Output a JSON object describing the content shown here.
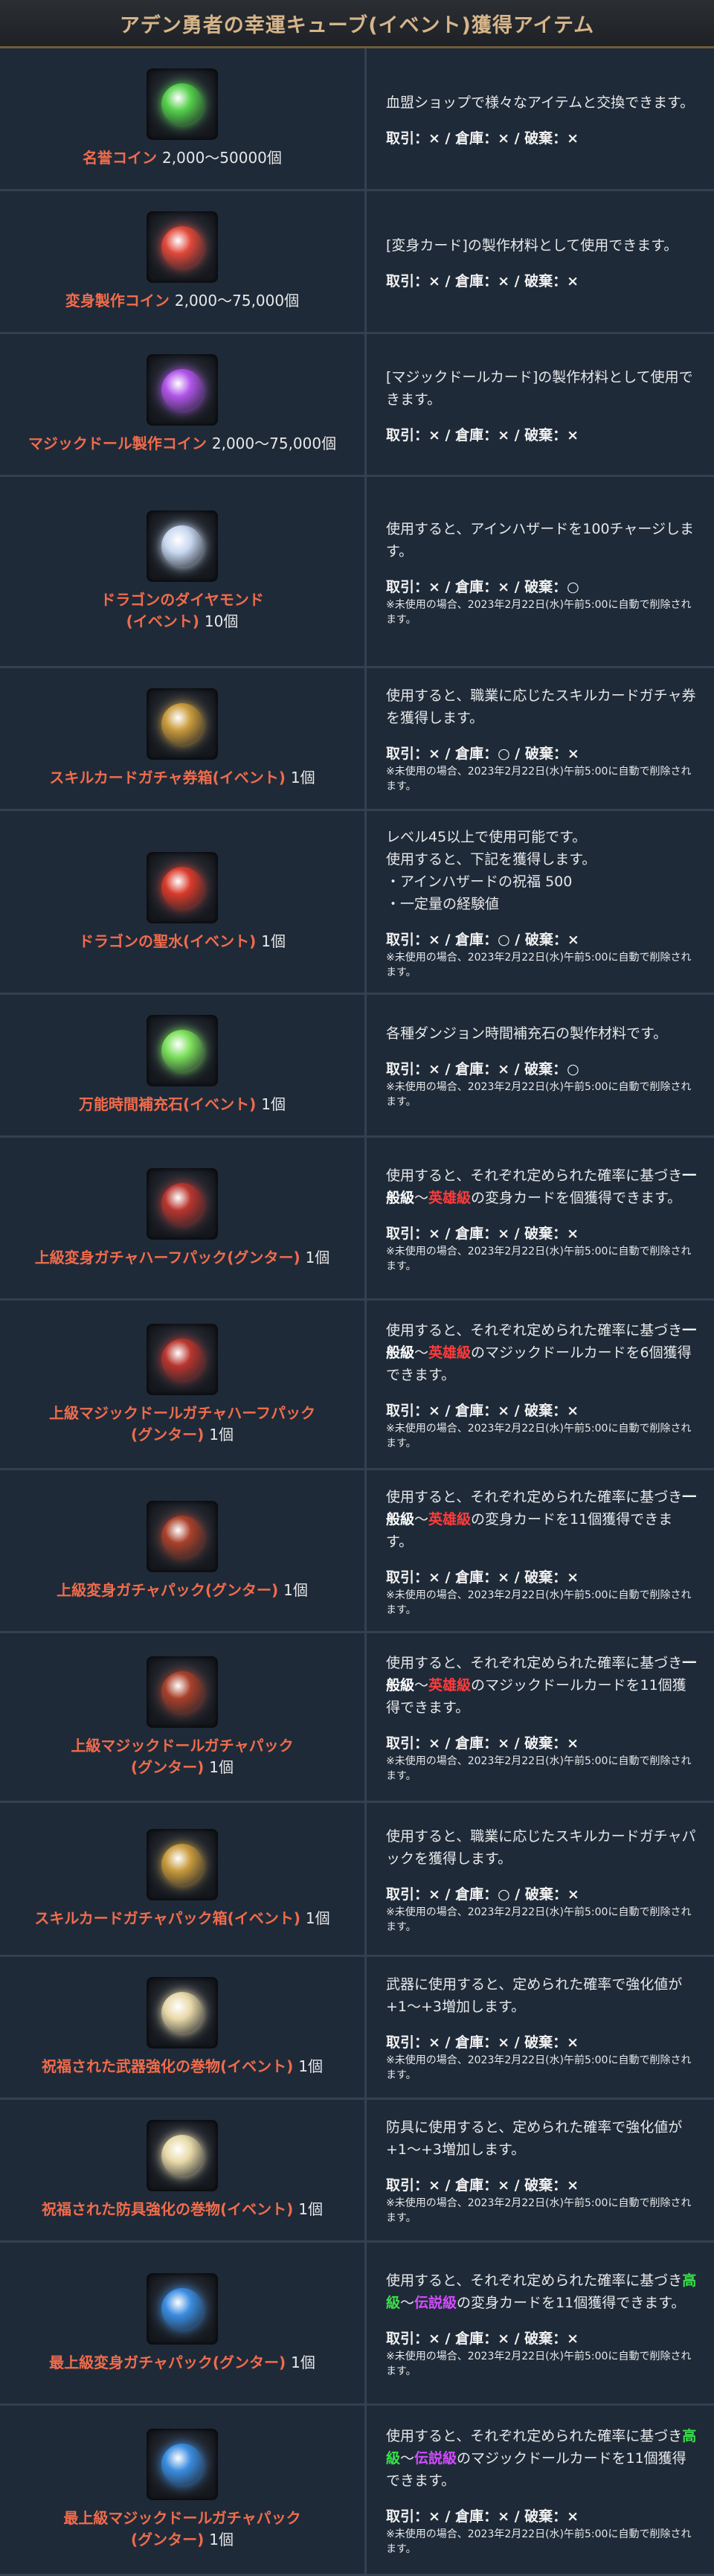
{
  "page": {
    "title": "アデン勇者の幸運キューブ(イベント)獲得アイテム"
  },
  "items": [
    {
      "name": "名誉コイン",
      "qty": "2,000～50000個",
      "icon": "green-coin-icon",
      "icon_color": "#54d04a",
      "desc": "血盟ショップで様々なアイテムと交換できます。",
      "trade": "取引：× / 倉庫：× / 破棄：×",
      "note": ""
    },
    {
      "name": "変身製作コイン",
      "qty": "2,000～75,000個",
      "icon": "red-coin-icon",
      "icon_color": "#e0483a",
      "desc": "[変身カード]の製作材料として使用できます。",
      "trade": "取引：× / 倉庫：× / 破棄：×",
      "note": ""
    },
    {
      "name": "マジックドール製作コイン",
      "qty": "2,000～75,000個",
      "icon": "purple-coin-icon",
      "icon_color": "#b054e8",
      "desc": "[マジックドールカード]の製作材料として使用できます。",
      "trade": "取引：× / 倉庫：× / 破棄：×",
      "note": ""
    },
    {
      "name": "ドラゴンのダイヤモンド\n(イベント)",
      "qty": "10個",
      "icon": "diamond-icon",
      "icon_color": "#c8d8f0",
      "desc": "使用すると、アインハザードを100チャージします。",
      "trade": "取引：× / 倉庫：× / 破棄：○",
      "note": "※未使用の場合、2023年2月22日(水)午前5:00に自動で削除されます。"
    },
    {
      "name": "スキルカードガチャ券箱(イベント)",
      "qty": "1個",
      "icon": "skill-ticket-box-icon",
      "icon_color": "#c89a3c",
      "desc": "使用すると、職業に応じたスキルカードガチャ券を獲得します。",
      "trade": "取引：× / 倉庫：○ / 破棄：×",
      "note": "※未使用の場合、2023年2月22日(水)午前5:00に自動で削除されます。"
    },
    {
      "name": "ドラゴンの聖水(イベント)",
      "qty": "1個",
      "icon": "holy-water-icon",
      "icon_color": "#d83a2a",
      "desc": "レベル45以上で使用可能です。\n使用すると、下記を獲得します。\n・アインハザードの祝福 500\n・一定量の経験値",
      "trade": "取引：× / 倉庫：○ / 破棄：×",
      "note": "※未使用の場合、2023年2月22日(水)午前5:00に自動で削除されます。"
    },
    {
      "name": "万能時間補充石(イベント)",
      "qty": "1個",
      "icon": "rainbow-stone-icon",
      "icon_color": "#7be05a",
      "desc": "各種ダンジョン時間補充石の製作材料です。",
      "trade": "取引：× / 倉庫：× / 破棄：○",
      "note": "※未使用の場合、2023年2月22日(水)午前5:00に自動で削除されます。"
    },
    {
      "name": "上級変身ガチャハーフパック(グンター)",
      "qty": "1個",
      "icon": "card-pack-icon",
      "icon_color": "#b8352e",
      "desc_parts": [
        {
          "t": "使用すると、それぞれ定められた確率に基づき",
          "c": ""
        },
        {
          "t": "一般級",
          "c": "gray"
        },
        {
          "t": "～",
          "c": ""
        },
        {
          "t": "英雄級",
          "c": "red"
        },
        {
          "t": "の変身カードを個獲得できます。",
          "c": ""
        }
      ],
      "trade": "取引：× / 倉庫：× / 破棄：×",
      "note": "※未使用の場合、2023年2月22日(水)午前5:00に自動で削除されます。"
    },
    {
      "name": "上級マジックドールガチャハーフパック\n(グンター)",
      "qty": "1個",
      "icon": "card-pack-icon",
      "icon_color": "#b8352e",
      "desc_parts": [
        {
          "t": "使用すると、それぞれ定められた確率に基づき",
          "c": ""
        },
        {
          "t": "一般級",
          "c": "gray"
        },
        {
          "t": "～",
          "c": ""
        },
        {
          "t": "英雄級",
          "c": "red"
        },
        {
          "t": "のマジックドールカードを6個獲得できます。",
          "c": ""
        }
      ],
      "trade": "取引：× / 倉庫：× / 破棄：×",
      "note": "※未使用の場合、2023年2月22日(水)午前5:00に自動で削除されます。"
    },
    {
      "name": "上級変身ガチャパック(グンター)",
      "qty": "1個",
      "icon": "card-pack-icon",
      "icon_color": "#a8402a",
      "desc_parts": [
        {
          "t": "使用すると、それぞれ定められた確率に基づき",
          "c": ""
        },
        {
          "t": "一般級",
          "c": "gray"
        },
        {
          "t": "～",
          "c": ""
        },
        {
          "t": "英雄級",
          "c": "red"
        },
        {
          "t": "の変身カードを11個獲得できます。",
          "c": ""
        }
      ],
      "trade": "取引：× / 倉庫：× / 破棄：×",
      "note": "※未使用の場合、2023年2月22日(水)午前5:00に自動で削除されます。"
    },
    {
      "name": "上級マジックドールガチャパック\n(グンター)",
      "qty": "1個",
      "icon": "card-pack-icon",
      "icon_color": "#a8402a",
      "desc_parts": [
        {
          "t": "使用すると、それぞれ定められた確率に基づき",
          "c": ""
        },
        {
          "t": "一般級",
          "c": "gray"
        },
        {
          "t": "～",
          "c": ""
        },
        {
          "t": "英雄級",
          "c": "red"
        },
        {
          "t": "のマジックドールカードを11個獲得できます。",
          "c": ""
        }
      ],
      "trade": "取引：× / 倉庫：× / 破棄：×",
      "note": "※未使用の場合、2023年2月22日(水)午前5:00に自動で削除されます。"
    },
    {
      "name": "スキルカードガチャパック箱(イベント)",
      "qty": "1個",
      "icon": "skill-pack-box-icon",
      "icon_color": "#c89a3c",
      "desc": "使用すると、職業に応じたスキルカードガチャパックを獲得します。",
      "trade": "取引：× / 倉庫：○ / 破棄：×",
      "note": "※未使用の場合、2023年2月22日(水)午前5:00に自動で削除されます。"
    },
    {
      "name": "祝福された武器強化の巻物(イベント)",
      "qty": "1個",
      "icon": "weapon-scroll-icon",
      "icon_color": "#e8d9a8",
      "desc": "武器に使用すると、定められた確率で強化値が+1～+3増加します。",
      "trade": "取引：× / 倉庫：× / 破棄：×",
      "note": "※未使用の場合、2023年2月22日(水)午前5:00に自動で削除されます。"
    },
    {
      "name": "祝福された防具強化の巻物(イベント)",
      "qty": "1個",
      "icon": "armor-scroll-icon",
      "icon_color": "#e8d9a8",
      "desc": "防具に使用すると、定められた確率で強化値が+1～+3増加します。",
      "trade": "取引：× / 倉庫：× / 破棄：×",
      "note": "※未使用の場合、2023年2月22日(水)午前5:00に自動で削除されます。"
    },
    {
      "name": "最上級変身ガチャパック(グンター)",
      "qty": "1個",
      "icon": "legend-card-pack-icon",
      "icon_color": "#3a8ce0",
      "desc_parts": [
        {
          "t": "使用すると、それぞれ定められた確率に基づき",
          "c": ""
        },
        {
          "t": "高級",
          "c": "green"
        },
        {
          "t": "～",
          "c": ""
        },
        {
          "t": "伝説級",
          "c": "purple"
        },
        {
          "t": "の変身カードを11個獲得できます。",
          "c": ""
        }
      ],
      "trade": "取引：× / 倉庫：× / 破棄：×",
      "note": "※未使用の場合、2023年2月22日(水)午前5:00に自動で削除されます。"
    },
    {
      "name": "最上級マジックドールガチャパック\n(グンター)",
      "qty": "1個",
      "icon": "legend-card-pack-icon",
      "icon_color": "#3a8ce0",
      "desc_parts": [
        {
          "t": "使用すると、それぞれ定められた確率に基づき",
          "c": ""
        },
        {
          "t": "高級",
          "c": "green"
        },
        {
          "t": "～",
          "c": ""
        },
        {
          "t": "伝説級",
          "c": "purple"
        },
        {
          "t": "のマジックドールカードを11個獲得できます。",
          "c": ""
        }
      ],
      "trade": "取引：× / 倉庫：× / 破棄：×",
      "note": "※未使用の場合、2023年2月22日(水)午前5:00に自動で削除されます。"
    }
  ]
}
